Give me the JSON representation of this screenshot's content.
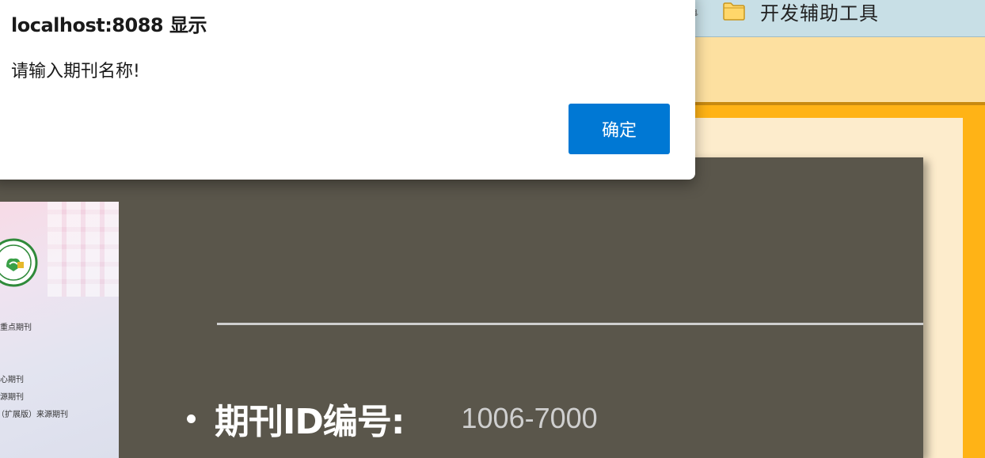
{
  "bookmarks_bar": {
    "folder_icon": "folder-icon",
    "folder_label": "开发辅助工具",
    "cut_item_text": "具"
  },
  "colors": {
    "bookmarks_bar": "#c8dfe6",
    "page_band": "#fde0a0",
    "orange_frame": "#ffb316",
    "cream_panel": "#fdeccc",
    "card_background": "#5a564b",
    "ok_button": "#0078d4"
  },
  "journal": {
    "cover_lines": [
      "重点期刊",
      "核心期刊",
      "来源期刊",
      "（扩展版）来源期刊"
    ],
    "id_label": "期刊ID编号:",
    "id_value": "1006-7000"
  },
  "alert": {
    "title": "localhost:8088 显示",
    "message": "请输入期刊名称!",
    "ok_label": "确定"
  }
}
